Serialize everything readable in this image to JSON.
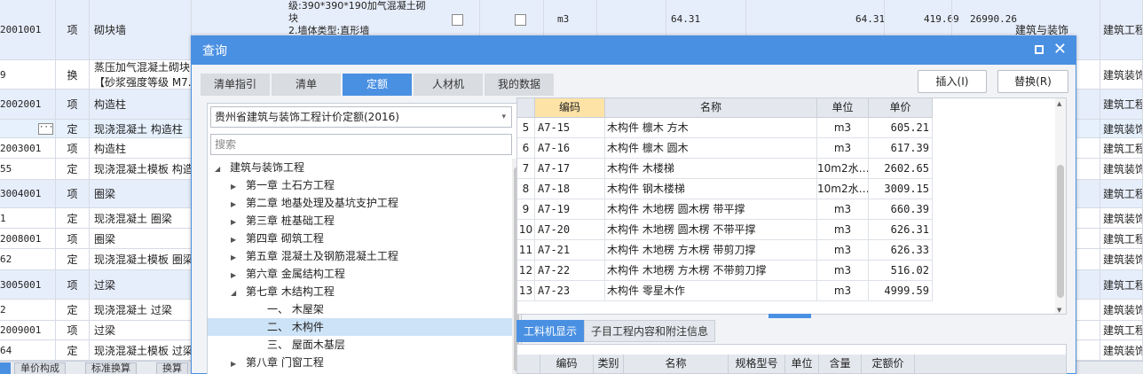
{
  "background": {
    "rows": [
      {
        "code": "2001001",
        "cat": "项",
        "name": "砌块墙",
        "tail1": "建筑与装饰",
        "tail2": "建筑工程",
        "style": "blue"
      },
      {
        "code": "9",
        "cat": "换",
        "name": "蒸压加气混凝土砌块",
        "name2": "【砂浆强度等级 M7.5】",
        "tail2": "建筑装饰",
        "style": "white"
      },
      {
        "code": "2002001",
        "cat": "项",
        "name": "构造柱",
        "tail2": "建筑工程",
        "style": "blue"
      },
      {
        "code": "",
        "cat": "定",
        "name": "现浇混凝土 构造柱",
        "tail2": "建筑装饰",
        "style": "sel"
      },
      {
        "code": "2003001",
        "cat": "项",
        "name": "构造柱",
        "tail2": "建筑工程",
        "style": "white"
      },
      {
        "code": "55",
        "cat": "定",
        "name": "现浇混凝土模板 构造柱",
        "tail2": "建筑装饰",
        "style": "white"
      },
      {
        "code": "3004001",
        "cat": "项",
        "name": "圈梁",
        "tail2": "建筑工程",
        "style": "blue"
      },
      {
        "code": "1",
        "cat": "定",
        "name": "现浇混凝土 圈梁",
        "tail2": "建筑装饰",
        "style": "white"
      },
      {
        "code": "2008001",
        "cat": "项",
        "name": "圈梁",
        "tail2": "建筑工程",
        "style": "white"
      },
      {
        "code": "62",
        "cat": "定",
        "name": "现浇混凝土模板 圈梁",
        "tail2": "建筑装饰",
        "style": "white"
      },
      {
        "code": "3005001",
        "cat": "项",
        "name": "过梁",
        "tail2": "建筑工程",
        "style": "blue"
      },
      {
        "code": "2",
        "cat": "定",
        "name": "现浇混凝土 过梁",
        "tail2": "建筑装饰",
        "style": "white"
      },
      {
        "code": "2009001",
        "cat": "项",
        "name": "过梁",
        "tail2": "建筑工程",
        "style": "white"
      },
      {
        "code": "64",
        "cat": "定",
        "name": "现浇混凝土模板 过梁",
        "tail2": "建筑装饰",
        "style": "white"
      }
    ],
    "row1_desc": [
      "级:390*390*190加气混凝土砌",
      "块",
      "2.墙体类型:直形墙"
    ],
    "row1_unit": "m3",
    "row1_qty1": "64.31",
    "row1_qty2": "64.31",
    "row1_price": "419.69",
    "row1_total": "26990.26",
    "bottom_tabs": [
      "单价构成",
      "标准换算",
      "换算"
    ]
  },
  "dialog": {
    "title": "查询",
    "tabs": [
      "清单指引",
      "清单",
      "定额",
      "人材机",
      "我的数据"
    ],
    "active_tab": 2,
    "insert_button": "插入(I)",
    "replace_button": "替换(R)",
    "library_select": "贵州省建筑与装饰工程计价定额(2016)",
    "search_placeholder": "搜索",
    "tree": [
      {
        "label": "建筑与装饰工程",
        "level": 0,
        "arrow": "expanded"
      },
      {
        "label": "第一章 土石方工程",
        "level": 1,
        "arrow": "collapsed"
      },
      {
        "label": "第二章 地基处理及基坑支护工程",
        "level": 1,
        "arrow": "collapsed"
      },
      {
        "label": "第三章 桩基础工程",
        "level": 1,
        "arrow": "collapsed"
      },
      {
        "label": "第四章 砌筑工程",
        "level": 1,
        "arrow": "collapsed"
      },
      {
        "label": "第五章 混凝土及钢筋混凝土工程",
        "level": 1,
        "arrow": "collapsed"
      },
      {
        "label": "第六章 金属结构工程",
        "level": 1,
        "arrow": "collapsed"
      },
      {
        "label": "第七章 木结构工程",
        "level": 1,
        "arrow": "expanded"
      },
      {
        "label": "一、 木屋架",
        "level": 2,
        "arrow": "none"
      },
      {
        "label": "二、 木构件",
        "level": 2,
        "arrow": "none",
        "selected": true
      },
      {
        "label": "三、 屋面木基层",
        "level": 2,
        "arrow": "none"
      },
      {
        "label": "第八章 门窗工程",
        "level": 1,
        "arrow": "collapsed"
      }
    ],
    "grid_headers": [
      "编码",
      "名称",
      "单位",
      "单价"
    ],
    "grid_rows": [
      {
        "num": "5",
        "code": "A7-15",
        "name": "木构件 檩木 方木",
        "unit": "m3",
        "price": "605.21"
      },
      {
        "num": "6",
        "code": "A7-16",
        "name": "木构件 檩木 圆木",
        "unit": "m3",
        "price": "617.39"
      },
      {
        "num": "7",
        "code": "A7-17",
        "name": "木构件 木楼梯",
        "unit": "10m2水…",
        "price": "2602.65"
      },
      {
        "num": "8",
        "code": "A7-18",
        "name": "木构件 钢木楼梯",
        "unit": "10m2水…",
        "price": "3009.15"
      },
      {
        "num": "9",
        "code": "A7-19",
        "name": "木构件 木地楞 圆木楞 带平撑",
        "unit": "m3",
        "price": "660.39"
      },
      {
        "num": "10",
        "code": "A7-20",
        "name": "木构件 木地楞 圆木楞 不带平撑",
        "unit": "m3",
        "price": "626.31"
      },
      {
        "num": "11",
        "code": "A7-21",
        "name": "木构件 木地楞 方木楞 带剪刀撑",
        "unit": "m3",
        "price": "626.33"
      },
      {
        "num": "12",
        "code": "A7-22",
        "name": "木构件 木地楞 方木楞 不带剪刀撑",
        "unit": "m3",
        "price": "516.02"
      },
      {
        "num": "13",
        "code": "A7-23",
        "name": "木构件 零星木作",
        "unit": "m3",
        "price": "4999.59"
      }
    ],
    "subtabs": [
      "工料机显示",
      "子目工程内容和附注信息"
    ],
    "subgrid_headers": [
      "编码",
      "类别",
      "名称",
      "规格型号",
      "单位",
      "含量",
      "定额价"
    ]
  },
  "colors": {
    "accent": "#4a90e2",
    "header_highlight": "#fde3a6",
    "selected_tree": "#cde3f7"
  }
}
